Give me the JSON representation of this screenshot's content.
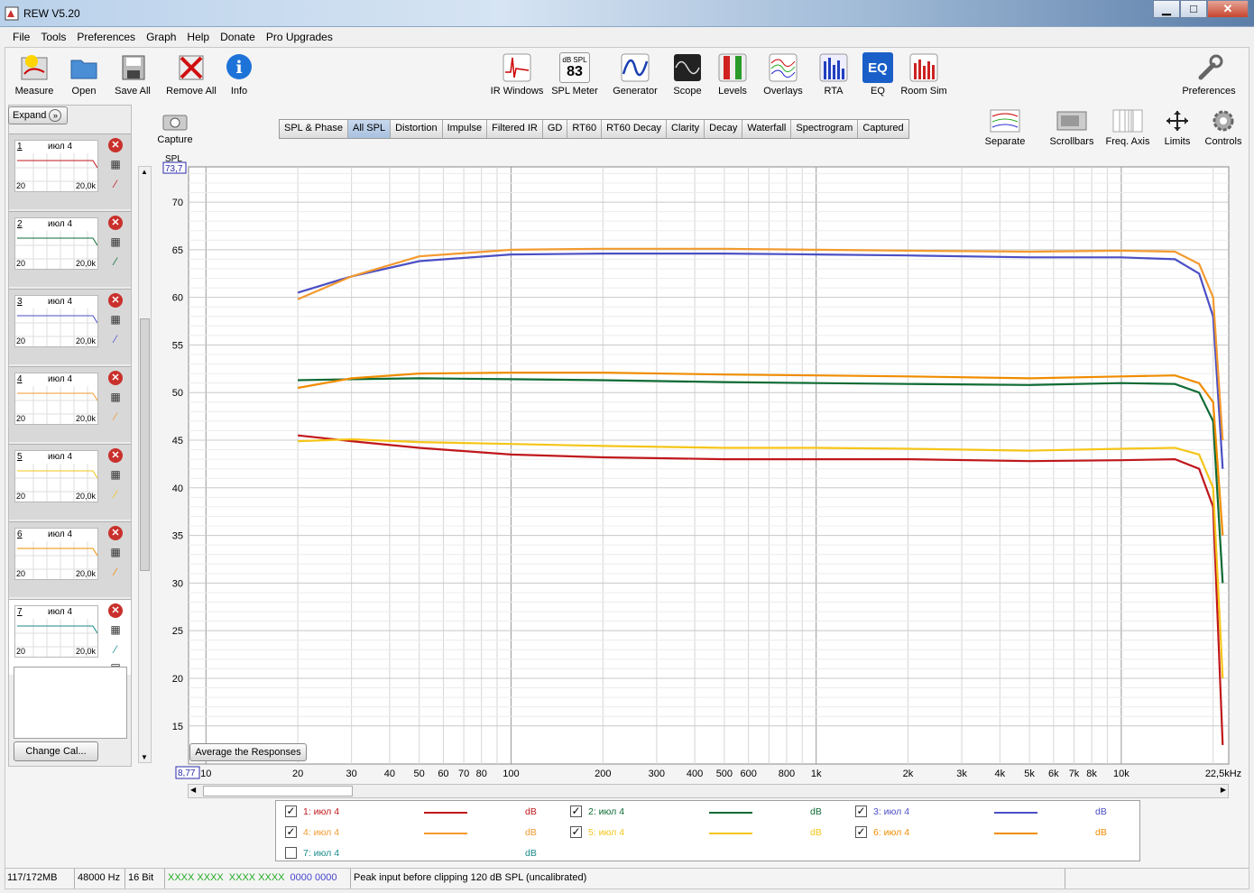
{
  "window": {
    "title": "REW V5.20",
    "min": "▁",
    "max": "□",
    "close": "✕"
  },
  "menu": [
    "File",
    "Tools",
    "Preferences",
    "Graph",
    "Help",
    "Donate",
    "Pro Upgrades"
  ],
  "toolbar": {
    "measure": "Measure",
    "open": "Open",
    "save_all": "Save All",
    "remove_all": "Remove All",
    "info": "Info",
    "ir_windows": "IR Windows",
    "spl_meter": "SPL Meter",
    "spl_meter_badge_top": "dB SPL",
    "spl_meter_badge_val": "83",
    "generator": "Generator",
    "scope": "Scope",
    "levels": "Levels",
    "overlays": "Overlays",
    "rta": "RTA",
    "eq": "EQ",
    "eq_badge": "EQ",
    "room_sim": "Room Sim",
    "preferences": "Preferences"
  },
  "capture": "Capture",
  "tabs": [
    "SPL & Phase",
    "All SPL",
    "Distortion",
    "Impulse",
    "Filtered IR",
    "GD",
    "RT60",
    "RT60 Decay",
    "Clarity",
    "Decay",
    "Waterfall",
    "Spectrogram",
    "Captured"
  ],
  "active_tab": "All SPL",
  "right_tools": {
    "separate": "Separate",
    "scrollbars": "Scrollbars",
    "freq_axis": "Freq. Axis",
    "limits": "Limits",
    "controls": "Controls"
  },
  "sidebar": {
    "expand": "Expand",
    "change_cal": "Change Cal...",
    "measurements": [
      {
        "num": "1",
        "name": "июл 4",
        "x_left": "20",
        "x_right": "20,0k",
        "color": "#c0171b"
      },
      {
        "num": "2",
        "name": "июл 4",
        "x_left": "20",
        "x_right": "20,0k",
        "color": "#0e6b34"
      },
      {
        "num": "3",
        "name": "июл 4",
        "x_left": "20",
        "x_right": "20,0k",
        "color": "#4b4fc4"
      },
      {
        "num": "4",
        "name": "июл 4",
        "x_left": "20",
        "x_right": "20,0k",
        "color": "#f39a2f"
      },
      {
        "num": "5",
        "name": "июл 4",
        "x_left": "20",
        "x_right": "20,0k",
        "color": "#f5c518"
      },
      {
        "num": "6",
        "name": "июл 4",
        "x_left": "20",
        "x_right": "20,0k",
        "color": "#f08c00"
      },
      {
        "num": "7",
        "name": "июл 4",
        "x_left": "20",
        "x_right": "20,0k",
        "color": "#1a8a8a"
      }
    ]
  },
  "chart_data": {
    "type": "line",
    "ylabel": "SPL",
    "ymax_readout": "73,7",
    "xmin_readout": "8,77",
    "x_scale": "log",
    "xlim": [
      8.77,
      22500
    ],
    "ylim": [
      11,
      73.7
    ],
    "y_ticks": [
      "70",
      "65",
      "60",
      "55",
      "50",
      "45",
      "40",
      "35",
      "30",
      "25",
      "20",
      "15"
    ],
    "x_ticks": [
      "10",
      "20",
      "30",
      "40",
      "50",
      "60",
      "70",
      "80",
      "100",
      "200",
      "300",
      "400",
      "500",
      "600",
      "800",
      "1k",
      "2k",
      "3k",
      "4k",
      "5k",
      "6k",
      "7k",
      "8k",
      "10k",
      "22,5kHz"
    ],
    "grid": true,
    "series": [
      {
        "name": "1: июл 4",
        "color": "#c0171b",
        "x": [
          20,
          30,
          50,
          100,
          200,
          500,
          1000,
          2000,
          5000,
          10000,
          15000,
          18000,
          20000,
          21500
        ],
        "values": [
          45.5,
          44.9,
          44.2,
          43.5,
          43.2,
          43.0,
          43.0,
          43.0,
          42.8,
          42.9,
          43.0,
          42.0,
          38,
          13
        ]
      },
      {
        "name": "2: июл 4",
        "color": "#0e6b34",
        "x": [
          20,
          30,
          50,
          100,
          200,
          500,
          1000,
          2000,
          5000,
          10000,
          15000,
          18000,
          20000,
          21500
        ],
        "values": [
          51.3,
          51.4,
          51.5,
          51.4,
          51.3,
          51.1,
          51.0,
          50.9,
          50.8,
          51.0,
          50.9,
          50.0,
          47,
          30
        ]
      },
      {
        "name": "3: июл 4",
        "color": "#4b4fc4",
        "x": [
          20,
          30,
          50,
          100,
          200,
          500,
          1000,
          2000,
          5000,
          10000,
          15000,
          18000,
          20000,
          21500
        ],
        "values": [
          60.5,
          62.2,
          63.8,
          64.5,
          64.6,
          64.6,
          64.5,
          64.4,
          64.2,
          64.2,
          64.0,
          62.5,
          58,
          42
        ]
      },
      {
        "name": "4: июл 4",
        "color": "#f39a2f",
        "x": [
          20,
          30,
          50,
          100,
          200,
          500,
          1000,
          2000,
          5000,
          10000,
          15000,
          18000,
          20000,
          21500
        ],
        "values": [
          59.8,
          62.2,
          64.3,
          65.0,
          65.1,
          65.1,
          65.0,
          64.9,
          64.8,
          64.9,
          64.8,
          63.5,
          60,
          45
        ]
      },
      {
        "name": "5: июл 4",
        "color": "#f5c518",
        "x": [
          20,
          30,
          50,
          100,
          200,
          500,
          1000,
          2000,
          5000,
          10000,
          15000,
          18000,
          20000,
          21500
        ],
        "values": [
          44.9,
          45.1,
          44.8,
          44.6,
          44.4,
          44.2,
          44.2,
          44.1,
          43.9,
          44.1,
          44.2,
          43.5,
          40,
          20
        ]
      },
      {
        "name": "6: июл 4",
        "color": "#f08c00",
        "x": [
          20,
          30,
          50,
          100,
          200,
          500,
          1000,
          2000,
          5000,
          10000,
          15000,
          18000,
          20000,
          21500
        ],
        "values": [
          50.5,
          51.5,
          52.0,
          52.1,
          52.1,
          51.9,
          51.8,
          51.7,
          51.5,
          51.7,
          51.8,
          51.0,
          49,
          35
        ]
      }
    ]
  },
  "avg_button": "Average the Responses",
  "legend": [
    {
      "label": "1: июл 4",
      "color": "#c0171b",
      "checked": true,
      "unit": "dB"
    },
    {
      "label": "2: июл 4",
      "color": "#0e6b34",
      "checked": true,
      "unit": "dB"
    },
    {
      "label": "3: июл 4",
      "color": "#4b4fc4",
      "checked": true,
      "unit": "dB"
    },
    {
      "label": "4: июл 4",
      "color": "#f39a2f",
      "checked": true,
      "unit": "dB"
    },
    {
      "label": "5: июл 4",
      "color": "#f5c518",
      "checked": true,
      "unit": "dB"
    },
    {
      "label": "6: июл 4",
      "color": "#f08c00",
      "checked": true,
      "unit": "dB"
    },
    {
      "label": "7: июл 4",
      "color": "#1a8a8a",
      "checked": false,
      "unit": "dB"
    }
  ],
  "status": {
    "memory": "117/172MB",
    "rate": "48000 Hz",
    "bits": "16 Bit",
    "l1": "XXXX XXXX",
    "l2": "XXXX XXXX",
    "l3": "0000 0000",
    "msg": "Peak input before clipping 120 dB SPL (uncalibrated)"
  }
}
